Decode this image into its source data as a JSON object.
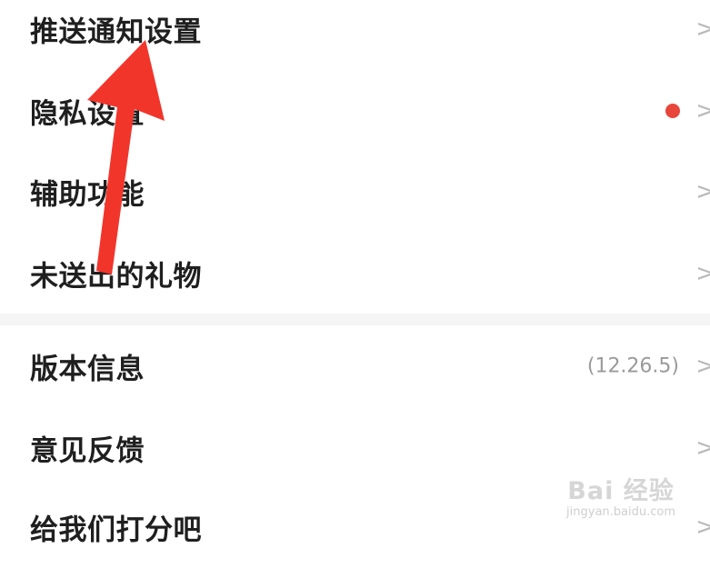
{
  "settings": {
    "items": [
      {
        "label": "推送通知设置"
      },
      {
        "label": "隐私设置",
        "badge_color": "#e8453c"
      },
      {
        "label": "辅助功能"
      },
      {
        "label": "未送出的礼物"
      },
      {
        "label": "版本信息",
        "value": "(12.26.5)"
      },
      {
        "label": "意见反馈"
      },
      {
        "label": "给我们打分吧"
      }
    ],
    "chevron": ">"
  },
  "annotation": {
    "arrow_icon": "red-arrow-icon",
    "arrow_color": "#f2352b"
  },
  "watermark": {
    "logo_text": "Bai 经验",
    "url": "jingyan.baidu.com"
  }
}
